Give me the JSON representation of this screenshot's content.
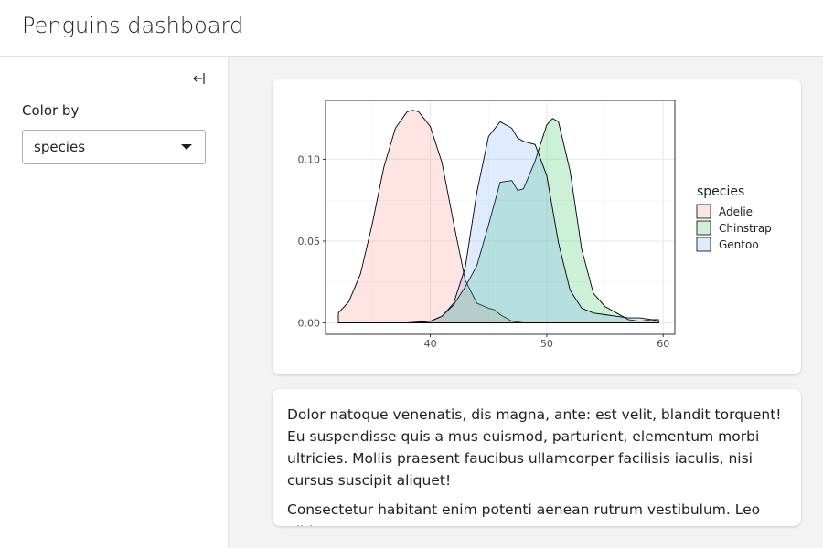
{
  "app": {
    "title": "Penguins dashboard"
  },
  "sidebar": {
    "collapse_icon": "collapse-sidebar-icon",
    "color_by": {
      "label": "Color by",
      "value": "species"
    }
  },
  "main": {
    "paragraphs": [
      "Dolor natoque venenatis, dis magna, ante: est velit, blandit torquent! Eu suspendisse quis a mus euismod, parturient, elementum morbi ultricies. Mollis praesent faucibus ullamcorper facilisis iaculis, nisi cursus suscipit aliquet!",
      "Consectetur habitant enim potenti aenean rutrum vestibulum. Leo nibh"
    ]
  },
  "chart_data": {
    "type": "area",
    "title": "",
    "xlabel": "",
    "ylabel": "",
    "xlim": [
      31,
      61
    ],
    "ylim": [
      -0.007,
      0.136
    ],
    "xticks": [
      40,
      50,
      60
    ],
    "yticks": [
      0.0,
      0.05,
      0.1
    ],
    "ytick_labels": [
      "0.00",
      "0.05",
      "0.10"
    ],
    "grid": true,
    "legend": {
      "title": "species",
      "placement": "right"
    },
    "series": [
      {
        "name": "Adelie",
        "fill": "#f8766d",
        "x": [
          32.1,
          33,
          34,
          35,
          36,
          37,
          38,
          38.5,
          39,
          40,
          41,
          42,
          43,
          44,
          45,
          45.5,
          46,
          47,
          48,
          49,
          50,
          51,
          52,
          53,
          54,
          55,
          56,
          57,
          58,
          59,
          59.6
        ],
        "y": [
          0.006,
          0.013,
          0.03,
          0.06,
          0.095,
          0.119,
          0.129,
          0.13,
          0.129,
          0.12,
          0.098,
          0.061,
          0.026,
          0.012,
          0.009,
          0.008,
          0.005,
          0.001,
          0,
          0,
          0,
          0,
          0,
          0,
          0,
          0,
          0,
          0,
          0,
          0,
          0
        ]
      },
      {
        "name": "Chinstrap",
        "fill": "#00ba38",
        "x": [
          32.1,
          36,
          39,
          40,
          41,
          42,
          43,
          44,
          45,
          46,
          47,
          47.5,
          48,
          49,
          50,
          50.5,
          51,
          52,
          53,
          54,
          55,
          56,
          57,
          58,
          59,
          59.6
        ],
        "y": [
          0,
          0,
          0,
          0.001,
          0.004,
          0.011,
          0.022,
          0.035,
          0.06,
          0.086,
          0.087,
          0.081,
          0.082,
          0.099,
          0.121,
          0.125,
          0.123,
          0.093,
          0.045,
          0.018,
          0.01,
          0.006,
          0.002,
          0.001,
          0.002,
          0.002
        ]
      },
      {
        "name": "Gentoo",
        "fill": "#619cff",
        "x": [
          32.1,
          38,
          40,
          41,
          42,
          43,
          44,
          45,
          46,
          47,
          47.5,
          48,
          49,
          50,
          51,
          52,
          53,
          54,
          55,
          56,
          57,
          58,
          59,
          59.6
        ],
        "y": [
          0,
          0,
          0.001,
          0.004,
          0.012,
          0.034,
          0.08,
          0.114,
          0.123,
          0.119,
          0.113,
          0.111,
          0.109,
          0.09,
          0.049,
          0.02,
          0.009,
          0.006,
          0.005,
          0.004,
          0.003,
          0.003,
          0.002,
          0.001
        ]
      }
    ]
  }
}
